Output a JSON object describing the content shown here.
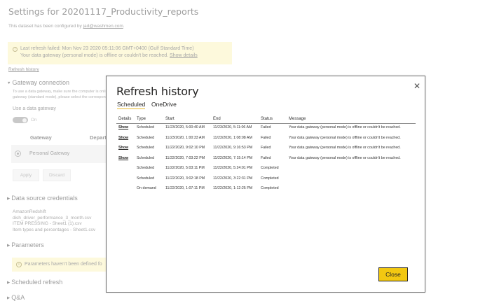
{
  "page": {
    "title": "Settings for 20201117_Productivity_reports",
    "configured_prefix": "This dataset has been configured by ",
    "configured_email": "jad@washmen.com",
    "configured_suffix": ".",
    "alert": {
      "icon": "warning-icon",
      "line1": "Last refresh failed: Mon Nov 23 2020 05:11:06 GMT+0400 (Gulf Standard Time)",
      "line2": "Your data gateway (personal mode) is offline or couldn't be reached.",
      "link": "Show details"
    },
    "refresh_history_link": "Refresh history",
    "gateway_connection": {
      "heading": "Gateway connection",
      "desc_line1": "To use a data gateway, make sure the computer is online",
      "desc_line2": "gateway (standard mode), please select the corresponding",
      "use_gateway_label": "Use a data gateway",
      "toggle_label": "On",
      "col_gateway": "Gateway",
      "col_department": "Depart",
      "gateway_row": "Personal Gateway",
      "apply": "Apply",
      "discard": "Discard"
    },
    "data_source_credentials": {
      "heading": "Data source credentials",
      "items": [
        "AmazonRedshift",
        "dish_driver_performance_3_month.csv",
        "ITEM PRESSING - Sheet1 (1).csv",
        "Item types and percentages - Sheet1.csv"
      ]
    },
    "parameters": {
      "heading": "Parameters",
      "message": "Parameters haven't been defined fo"
    },
    "scheduled_refresh": {
      "heading": "Scheduled refresh"
    },
    "qa": {
      "heading": "Q&A"
    }
  },
  "modal": {
    "title": "Refresh history",
    "close_icon": "close-icon",
    "tabs": [
      {
        "label": "Scheduled",
        "active": true
      },
      {
        "label": "OneDrive",
        "active": false
      }
    ],
    "columns": [
      "Details",
      "Type",
      "Start",
      "End",
      "Status",
      "Message"
    ],
    "rows": [
      {
        "details": "Show",
        "type": "Scheduled",
        "start": "11/23/2020, 5:00:40 AM",
        "end": "11/23/2020, 5:11:06 AM",
        "status": "Failed",
        "message": "Your data gateway (personal mode) is offline or couldn't be reached."
      },
      {
        "details": "Show",
        "type": "Scheduled",
        "start": "11/23/2020, 1:00:33 AM",
        "end": "11/23/2020, 1:08:08 AM",
        "status": "Failed",
        "message": "Your data gateway (personal mode) is offline or couldn't be reached."
      },
      {
        "details": "Show",
        "type": "Scheduled",
        "start": "11/22/2020, 9:02:10 PM",
        "end": "11/22/2020, 9:16:53 PM",
        "status": "Failed",
        "message": "Your data gateway (personal mode) is offline or couldn't be reached."
      },
      {
        "details": "Show",
        "type": "Scheduled",
        "start": "11/22/2020, 7:03:22 PM",
        "end": "11/22/2020, 7:15:14 PM",
        "status": "Failed",
        "message": "Your data gateway (personal mode) is offline or couldn't be reached."
      },
      {
        "details": "",
        "type": "Scheduled",
        "start": "11/22/2020, 5:03:11 PM",
        "end": "11/22/2020, 5:24:01 PM",
        "status": "Completed",
        "message": ""
      },
      {
        "details": "",
        "type": "Scheduled",
        "start": "11/22/2020, 3:02:18 PM",
        "end": "11/22/2020, 3:22:31 PM",
        "status": "Completed",
        "message": ""
      },
      {
        "details": "",
        "type": "On demand",
        "start": "11/22/2020, 1:07:11 PM",
        "end": "11/22/2020, 1:12:25 PM",
        "status": "Completed",
        "message": ""
      }
    ],
    "close_button": "Close",
    "colors": {
      "accent": "#f2c811",
      "tab_underline": "#e8b82a"
    }
  }
}
